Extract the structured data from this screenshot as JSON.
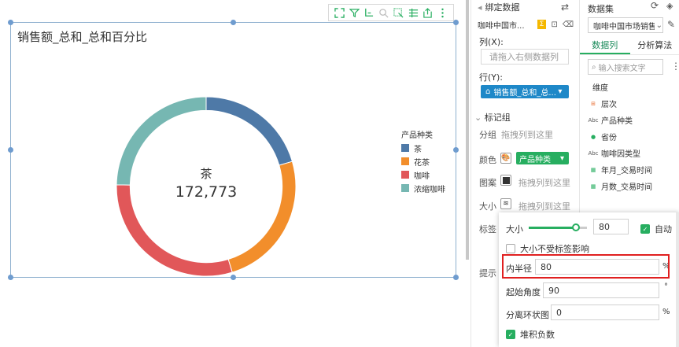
{
  "chart": {
    "title": "销售额_总和_总和百分比",
    "center_label": "茶",
    "center_value": "172,773"
  },
  "chart_data": {
    "type": "pie",
    "title": "销售额_总和_总和百分比",
    "legend_title": "产品种类",
    "legend_position": "right",
    "inner_radius_percent": 80,
    "start_angle": 90,
    "series": [
      {
        "name": "茶",
        "value": 0.205,
        "color": "#4e79a7"
      },
      {
        "name": "花茶",
        "value": 0.248,
        "color": "#f28e2b"
      },
      {
        "name": "咖啡",
        "value": 0.3,
        "color": "#e15759"
      },
      {
        "name": "浓缩咖啡",
        "value": 0.247,
        "color": "#76b7b2"
      }
    ]
  },
  "binding": {
    "header": "绑定数据",
    "dataset_name": "咖啡中国市...",
    "columns_label": "列(X):",
    "columns_placeholder": "请拖入右侧数据列",
    "rows_label": "行(Y):",
    "rows_value": "销售额_总和_总...",
    "mark_group": "标记组",
    "group_label": "分组",
    "drag_here": "拖拽列到这里",
    "color_label": "颜色",
    "color_value": "产品种类",
    "pattern_label": "图案",
    "size_label": "大小",
    "tag_label": "标签",
    "tip_label": "提示"
  },
  "dataset": {
    "header": "数据集",
    "selected": "咖啡中国市场销售",
    "tab_columns": "数据列",
    "tab_algorithms": "分析算法",
    "search_placeholder": "输入搜索文字",
    "dimension_label": "维度",
    "fields": [
      {
        "icon": "hierarchy-icon",
        "name": "层次"
      },
      {
        "icon": "abc-icon",
        "name": "产品种类"
      },
      {
        "icon": "globe-icon",
        "name": "省份"
      },
      {
        "icon": "abc-icon",
        "name": "咖啡因类型"
      },
      {
        "icon": "calendar-icon",
        "name": "年月_交易时间"
      },
      {
        "icon": "calendar-icon",
        "name": "月数_交易时间"
      }
    ]
  },
  "popup": {
    "size_label": "大小",
    "size_value": "80",
    "auto_label": "自动",
    "size_independent_label": "大小不受标签影响",
    "inner_radius_label": "内半径",
    "inner_radius_value": "80",
    "percent": "%",
    "start_angle_label": "起始角度",
    "start_angle_value": "90",
    "start_angle_unit": "°",
    "separate_label": "分离环状图",
    "separate_value": "0",
    "stack_negative_label": "堆积负数"
  },
  "colors": {
    "accent_green": "#27ae60",
    "accent_blue": "#1e88c8",
    "highlight_red": "#e02020"
  }
}
